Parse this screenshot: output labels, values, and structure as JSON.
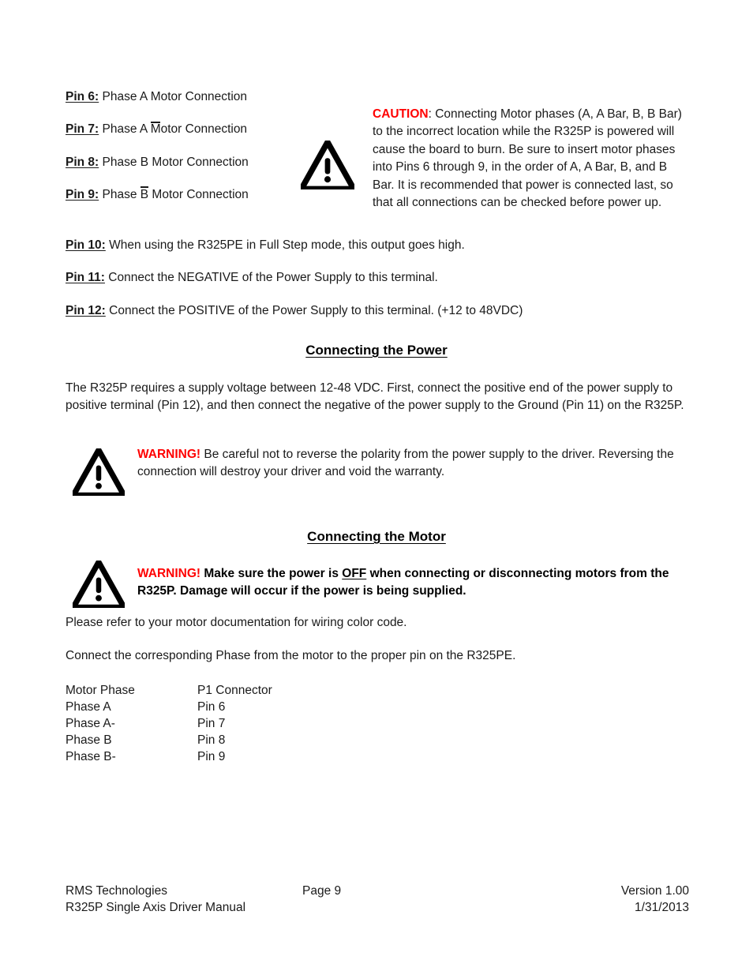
{
  "document": {
    "title": "R325P Single Axis Driver Manual - Page 9"
  },
  "pins_top": [
    {
      "label": "Pin 6:",
      "pre": " Phase A Motor Connection",
      "bar": null,
      "post": null
    },
    {
      "label": "Pin 7:",
      "pre": " Phase A ",
      "bar": "M",
      "post": "otor Connection"
    },
    {
      "label": "Pin 8:",
      "pre": " Phase B Motor Connection",
      "bar": null,
      "post": null
    },
    {
      "label": "Pin 9:",
      "pre": " Phase ",
      "bar": "B",
      "post": " Motor Connection"
    }
  ],
  "pins_bottom": [
    {
      "label": "Pin 10:",
      "text": " When using the R325PE in Full Step mode, this output goes high."
    },
    {
      "label": "Pin 11:",
      "text": " Connect the NEGATIVE of the Power Supply to this terminal."
    },
    {
      "label": "Pin 12:",
      "text": " Connect the POSITIVE of the Power Supply to this terminal. (+12 to 48VDC)"
    }
  ],
  "caution": {
    "icon": "warning-triangle-icon",
    "keyword": "CAUTION",
    "text": ": Connecting Motor phases (A, A Bar, B, B Bar) to the incorrect location while the R325P is powered will cause the board to burn.  Be sure to insert motor phases into Pins 6 through 9, in the order of A, A Bar, B, and B Bar.  It is recommended that power is connected last, so that all connections can be checked before power up."
  },
  "section_power": {
    "heading": "Connecting the Power",
    "paragraph": "The R325P requires a supply voltage between 12-48 VDC.  First, connect the positive end of the power supply to positive terminal (Pin 12), and then connect the negative of the power supply to the Ground (Pin 11) on the R325P."
  },
  "warning_power": {
    "icon": "warning-triangle-icon",
    "keyword": "WARNING!",
    "text": "  Be careful not to reverse the polarity from the power supply to the driver.  Reversing the connection will destroy your driver and void the warranty."
  },
  "section_motor": {
    "heading": "Connecting the Motor",
    "paragraph_1": "Please refer to your motor documentation for wiring color code.",
    "paragraph_2": "Connect the corresponding Phase from the motor to the proper pin on the R325PE."
  },
  "warning_motor": {
    "icon": "warning-triangle-icon",
    "keyword": "WARNING!",
    "text_before": "  Make sure the power is ",
    "emphasis": "OFF",
    "text_after": " when connecting or disconnecting motors from the R325P.  Damage will occur if the power is being supplied."
  },
  "phase_table": {
    "headers": [
      "Motor Phase",
      "P1 Connector"
    ],
    "rows": [
      [
        "Phase A",
        "Pin 6"
      ],
      [
        "Phase A-",
        "Pin 7"
      ],
      [
        "Phase B",
        "Pin 8"
      ],
      [
        "Phase B-",
        "Pin 9"
      ]
    ]
  },
  "footer": {
    "company": "RMS Technologies",
    "manual": "R325P Single Axis Driver Manual",
    "page": "Page 9",
    "version": "Version 1.00",
    "date": "1/31/2013"
  },
  "colors": {
    "alert_red": "#FF0000",
    "text": "#1a1a1a",
    "background": "#ffffff"
  }
}
